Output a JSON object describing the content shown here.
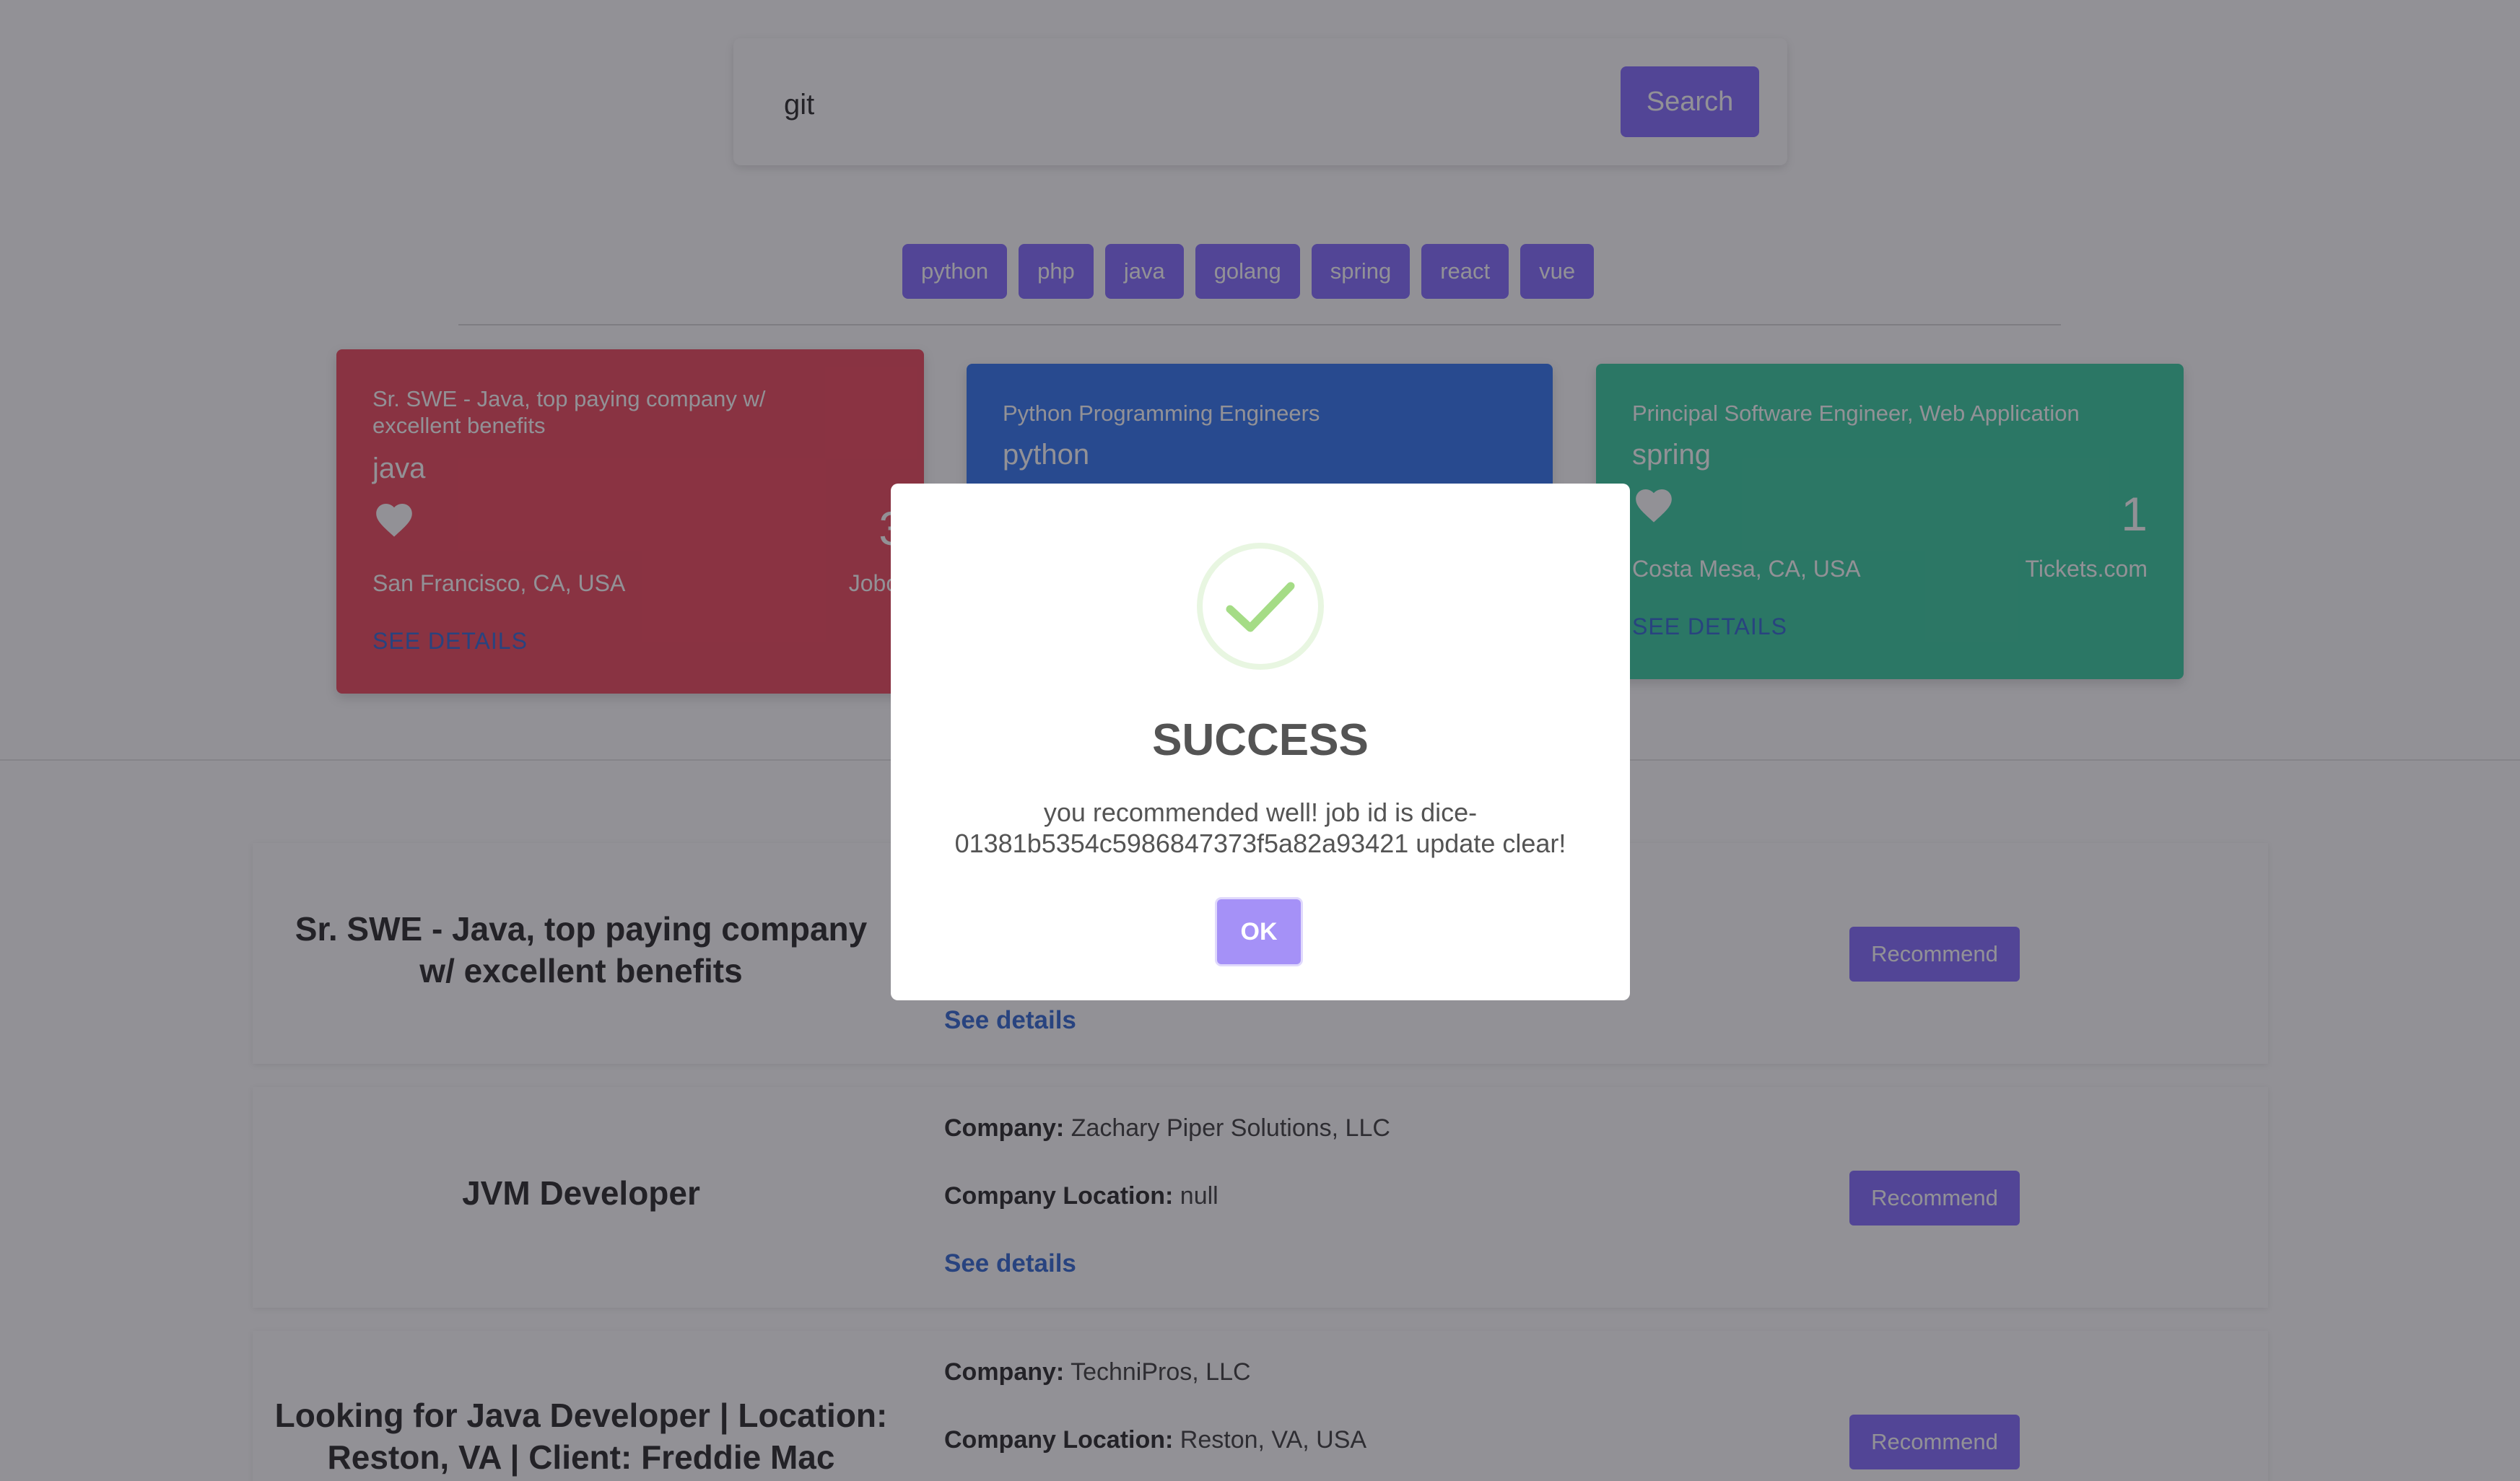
{
  "search": {
    "value": "git",
    "button_label": "Search"
  },
  "tags": [
    "python",
    "php",
    "java",
    "golang",
    "spring",
    "react",
    "vue"
  ],
  "cards": [
    {
      "title": "Sr. SWE - Java, top paying company w/ excellent benefits",
      "skill": "java",
      "count": "3",
      "location": "San Francisco, CA, USA",
      "company": "Jobot",
      "link": "SEE DETAILS",
      "color": "#ef5466"
    },
    {
      "title": "Python Programming Engineers",
      "skill": "python",
      "color": "#3e7ff2"
    },
    {
      "title": "Principal Software Engineer, Web Application",
      "skill": "spring",
      "count": "1",
      "location": "Costa Mesa, CA, USA",
      "company": "Tickets.com",
      "link": "SEE DETAILS",
      "color": "#44d0a6"
    }
  ],
  "jobs": [
    {
      "title": "Sr. SWE - Java, top paying company w/ excellent benefits",
      "link": "See details",
      "button": "Recommend"
    },
    {
      "title": "JVM Developer",
      "company_label": "Company:",
      "company": "Zachary Piper Solutions, LLC",
      "location_label": "Company Location:",
      "location": "null",
      "link": "See details",
      "button": "Recommend"
    },
    {
      "title": "Looking for Java Developer | Location: Reston, VA | Client: Freddie Mac",
      "company_label": "Company:",
      "company": "TechniPros, LLC",
      "location_label": "Company Location:",
      "location": "Reston, VA, USA",
      "button": "Recommend"
    }
  ],
  "modal": {
    "title": "SUCCESS",
    "message": "you recommended well! job id is dice-01381b5354c5986847373f5a82a93421 update clear!",
    "ok_label": "OK",
    "icon": "checkmark-icon"
  },
  "colors": {
    "accent": "#8a76ff",
    "link": "#3e71d6",
    "success": "#a5dc86"
  }
}
